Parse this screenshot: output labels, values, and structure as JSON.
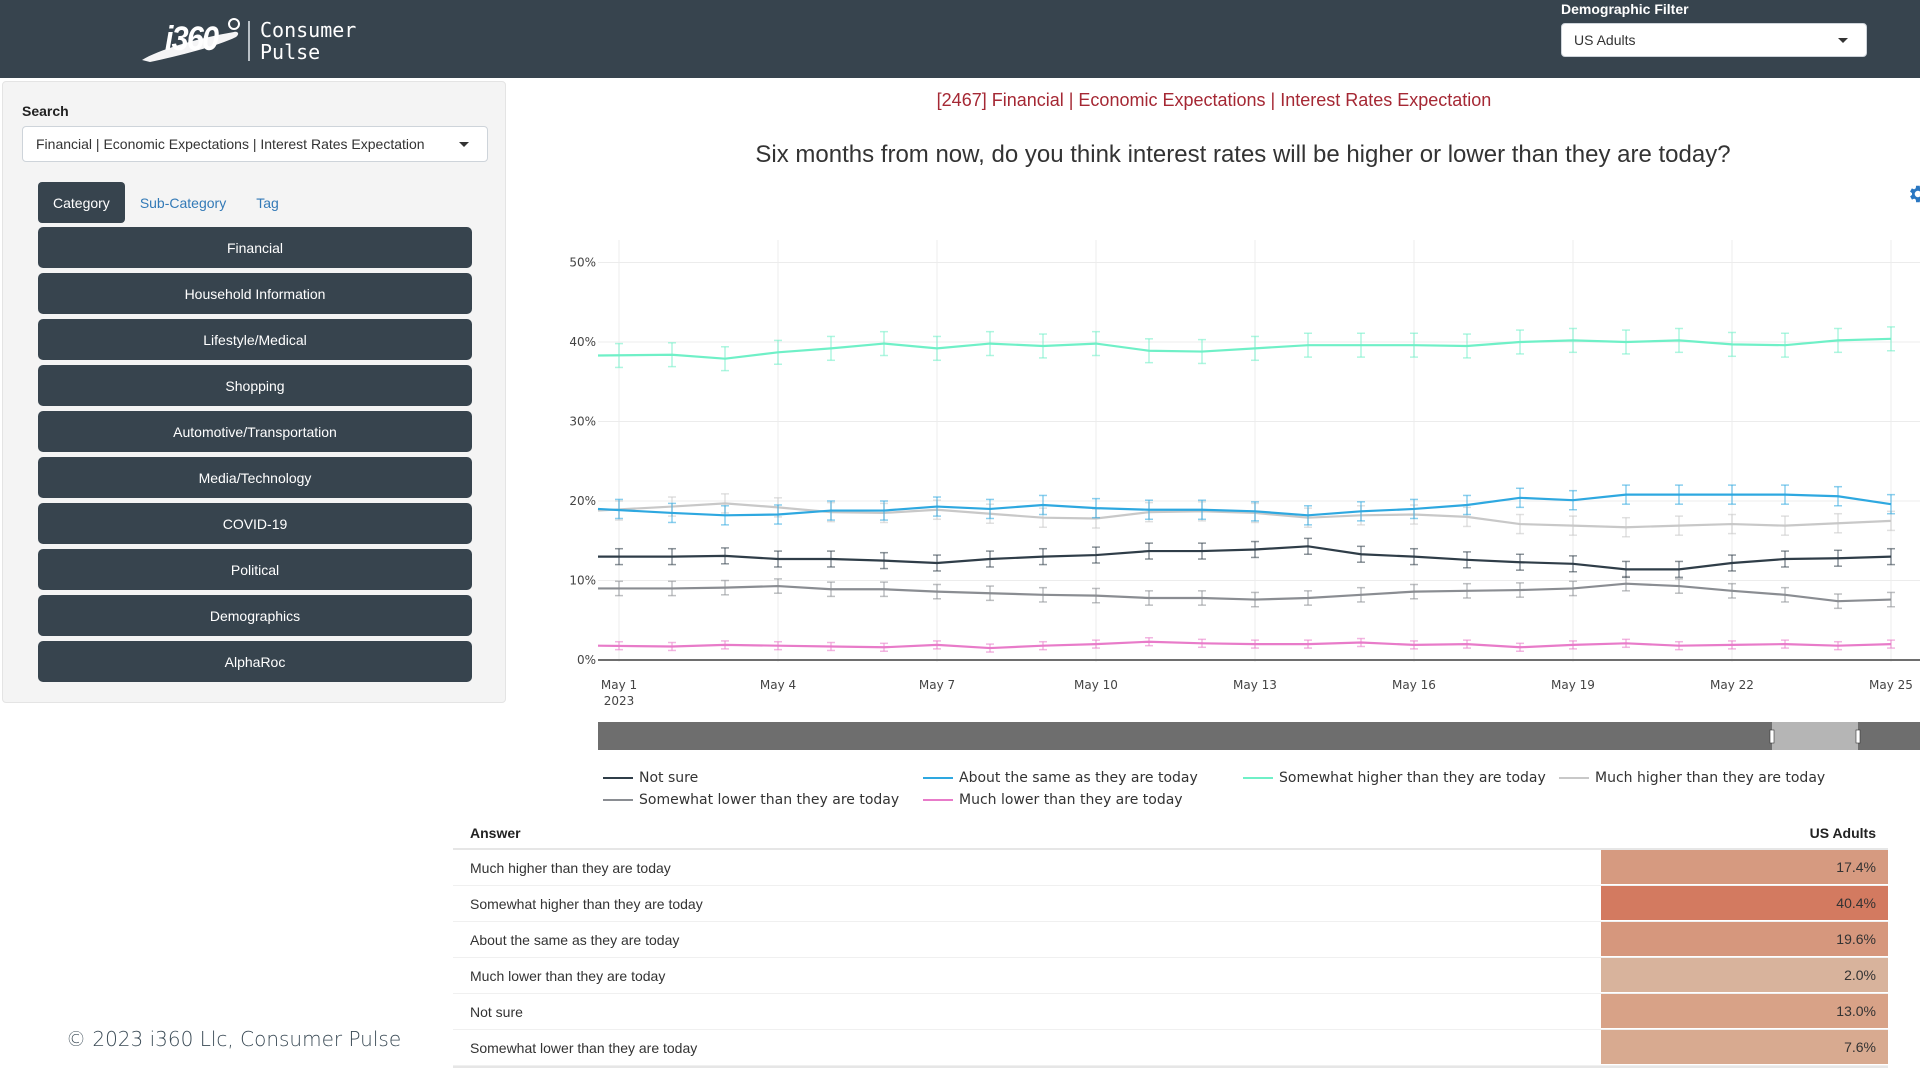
{
  "header": {
    "logo_mark": "i360",
    "logo_text_line1": "Consumer",
    "logo_text_line2": "Pulse",
    "demographic_filter": {
      "label": "Demographic Filter",
      "selected": "US Adults"
    }
  },
  "sidebar": {
    "search_label": "Search",
    "search_selected": "Financial | Economic Expectations | Interest Rates Expectation",
    "tabs": [
      {
        "label": "Category",
        "active": true
      },
      {
        "label": "Sub-Category",
        "active": false
      },
      {
        "label": "Tag",
        "active": false
      }
    ],
    "categories": [
      "Financial",
      "Household Information",
      "Lifestyle/Medical",
      "Shopping",
      "Automotive/Transportation",
      "Media/Technology",
      "COVID-19",
      "Political",
      "Demographics",
      "AlphaRoc"
    ]
  },
  "main": {
    "breadcrumb": "[2467] Financial | Economic Expectations | Interest Rates Expectation",
    "question": "Six months from now, do you think interest rates will be higher or lower than they are today?",
    "accent_color": "#a52834",
    "range_slider": {
      "window_start": "May 23",
      "window_end": "May 25"
    }
  },
  "chart_data": {
    "type": "line",
    "title": "Six months from now, do you think interest rates will be higher or lower than they are today?",
    "xlabel": "",
    "ylabel": "",
    "y_tick_labels": [
      "0%",
      "10%",
      "20%",
      "30%",
      "40%",
      "50%"
    ],
    "ylim": [
      0,
      52
    ],
    "x_tick_labels": [
      "May 1",
      "May 4",
      "May 7",
      "May 10",
      "May 13",
      "May 16",
      "May 19",
      "May 22",
      "May 25"
    ],
    "x_tick_sublabel": "2023",
    "x": [
      "May 1",
      "May 2",
      "May 3",
      "May 4",
      "May 5",
      "May 6",
      "May 7",
      "May 8",
      "May 9",
      "May 10",
      "May 11",
      "May 12",
      "May 13",
      "May 14",
      "May 15",
      "May 16",
      "May 17",
      "May 18",
      "May 19",
      "May 20",
      "May 21",
      "May 22",
      "May 23",
      "May 24",
      "May 25"
    ],
    "grid": true,
    "error_bars": true,
    "legend_position": "bottom",
    "series": [
      {
        "name": "Not sure",
        "color": "#2f3d48",
        "err": 1.0,
        "values": [
          13.0,
          13.0,
          13.1,
          12.7,
          12.7,
          12.5,
          12.2,
          12.7,
          13.0,
          13.2,
          13.7,
          13.7,
          13.9,
          14.3,
          13.3,
          13.0,
          12.6,
          12.3,
          12.1,
          11.4,
          11.4,
          12.2,
          12.7,
          12.8,
          13.0
        ]
      },
      {
        "name": "Somewhat lower than they are today",
        "color": "#8a8d92",
        "err": 0.9,
        "values": [
          9.0,
          9.0,
          9.1,
          9.3,
          8.9,
          8.9,
          8.6,
          8.4,
          8.2,
          8.1,
          7.8,
          7.8,
          7.6,
          7.8,
          8.2,
          8.6,
          8.7,
          8.8,
          9.0,
          9.6,
          9.3,
          8.7,
          8.2,
          7.4,
          7.6
        ]
      },
      {
        "name": "About the same as they are today",
        "color": "#2ea8e0",
        "err": 1.2,
        "values": [
          19.0,
          18.5,
          18.2,
          18.3,
          18.8,
          18.8,
          19.3,
          19.0,
          19.5,
          19.1,
          18.9,
          18.9,
          18.7,
          18.2,
          18.7,
          19.0,
          19.5,
          20.4,
          20.1,
          20.8,
          20.8,
          20.8,
          20.8,
          20.6,
          19.6
        ]
      },
      {
        "name": "Much lower than they are today",
        "color": "#e87bc9",
        "err": 0.5,
        "values": [
          1.8,
          1.7,
          1.9,
          1.8,
          1.7,
          1.6,
          1.9,
          1.5,
          1.8,
          2.0,
          2.3,
          2.1,
          2.0,
          2.0,
          2.2,
          1.9,
          2.0,
          1.6,
          1.9,
          2.1,
          1.8,
          1.9,
          2.0,
          1.8,
          2.0
        ]
      },
      {
        "name": "Somewhat higher than they are today",
        "color": "#6ff0c7",
        "err": 1.5,
        "values": [
          38.3,
          38.4,
          37.9,
          38.7,
          39.2,
          39.8,
          39.2,
          39.8,
          39.5,
          39.8,
          38.9,
          38.8,
          39.2,
          39.6,
          39.6,
          39.6,
          39.5,
          40.0,
          40.2,
          40.0,
          40.2,
          39.7,
          39.6,
          40.2,
          40.4
        ]
      },
      {
        "name": "Much higher than they are today",
        "color": "#c8c8c8",
        "err": 1.2,
        "values": [
          18.8,
          19.3,
          19.7,
          19.2,
          18.6,
          18.5,
          18.9,
          18.4,
          17.9,
          17.8,
          18.6,
          18.7,
          18.5,
          17.9,
          18.2,
          18.3,
          18.0,
          17.1,
          16.9,
          16.7,
          16.9,
          17.1,
          16.9,
          17.2,
          17.5
        ]
      }
    ]
  },
  "legend": {
    "rows": [
      [
        "Not sure",
        "About the same as they are today",
        "Somewhat higher than they are today",
        "Much higher than they are today"
      ],
      [
        "Somewhat lower than they are today",
        "Much lower than they are today"
      ]
    ]
  },
  "table": {
    "headers": [
      "Answer",
      "US Adults"
    ],
    "rows": [
      {
        "answer": "Much higher than they are today",
        "value": "17.4%",
        "color": "#d69a80"
      },
      {
        "answer": "Somewhat higher than they are today",
        "value": "40.4%",
        "color": "#d37a60"
      },
      {
        "answer": "About the same as they are today",
        "value": "19.6%",
        "color": "#d6977d"
      },
      {
        "answer": "Much lower than they are today",
        "value": "2.0%",
        "color": "#d8b39c"
      },
      {
        "answer": "Not sure",
        "value": "13.0%",
        "color": "#d8a287"
      },
      {
        "answer": "Somewhat lower than they are today",
        "value": "7.6%",
        "color": "#d8aa90"
      }
    ]
  },
  "footer": {
    "copyright": "© 2023 i360 Llc, Consumer Pulse"
  }
}
